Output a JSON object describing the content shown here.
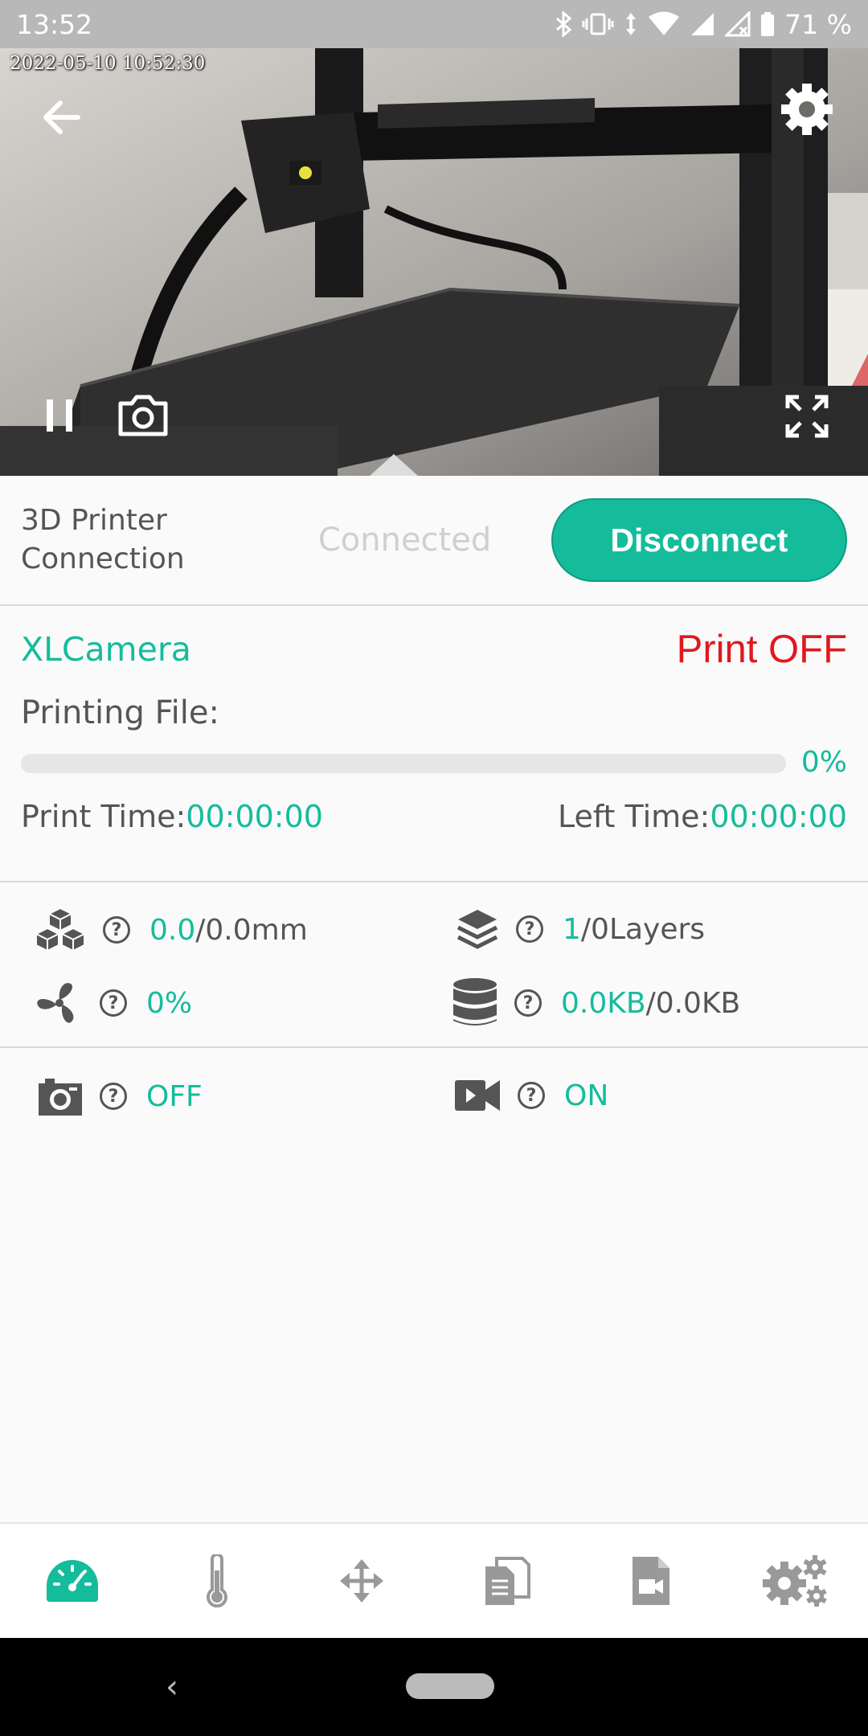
{
  "status_bar": {
    "time": "13:52",
    "battery": "71 %"
  },
  "camera": {
    "timestamp": "2022-05-10 10:52:30"
  },
  "connection": {
    "label_line1": "3D Printer",
    "label_line2": "Connection",
    "status": "Connected",
    "button": "Disconnect"
  },
  "print_info": {
    "device": "XLCamera",
    "state": "Print OFF",
    "printing_file_label": "Printing File:",
    "progress": "0%",
    "progress_fraction": 0,
    "print_time_label": "Print Time:",
    "print_time": "00:00:00",
    "left_time_label": "Left Time:",
    "left_time": "00:00:00"
  },
  "stats": {
    "height_current": "0.0",
    "height_total": "/0.0mm",
    "layers_current": "1",
    "layers_total": "/0Layers",
    "fan": "0%",
    "data_current": "0.0KB",
    "data_total": "/0.0KB"
  },
  "media": {
    "snapshot": "OFF",
    "video": "ON"
  },
  "colors": {
    "accent": "#14bc9c",
    "alert": "#e0191d"
  },
  "nav": [
    "dashboard-icon",
    "thermometer-icon",
    "move-icon",
    "files-icon",
    "video-file-icon",
    "settings-icon"
  ]
}
